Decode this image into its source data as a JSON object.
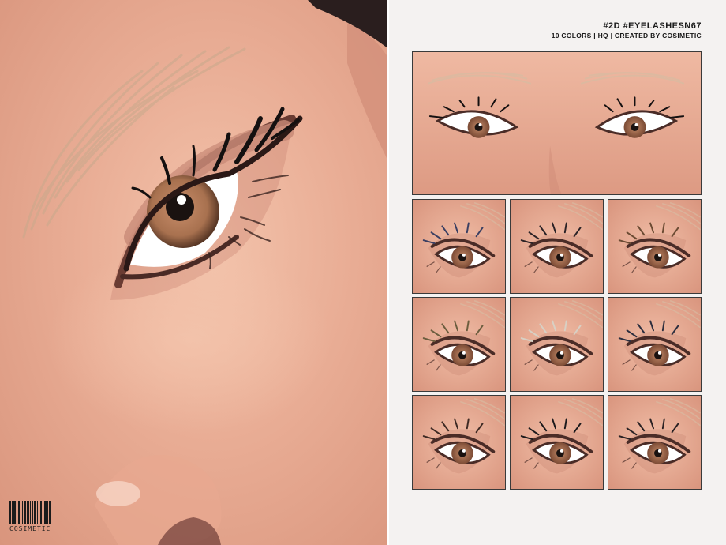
{
  "header": {
    "title": "#2D #EYELASHESN67",
    "subtitle": "10 COLORS | HQ | CREATED BY COSIMETIC"
  },
  "brand": {
    "barcode_text": "COSIMETIC"
  },
  "swatches": {
    "lash_colors": [
      "#3a3f62",
      "#2a2226",
      "#6b4b33",
      "#6b5d3e",
      "#d8d0c4",
      "#2c2e3e",
      "#3e2a24",
      "#1c1a1c",
      "#2a2224"
    ]
  },
  "colors": {
    "skin": "#eab29a",
    "liner": "#5a3a33",
    "iris": "#b07a5c"
  }
}
